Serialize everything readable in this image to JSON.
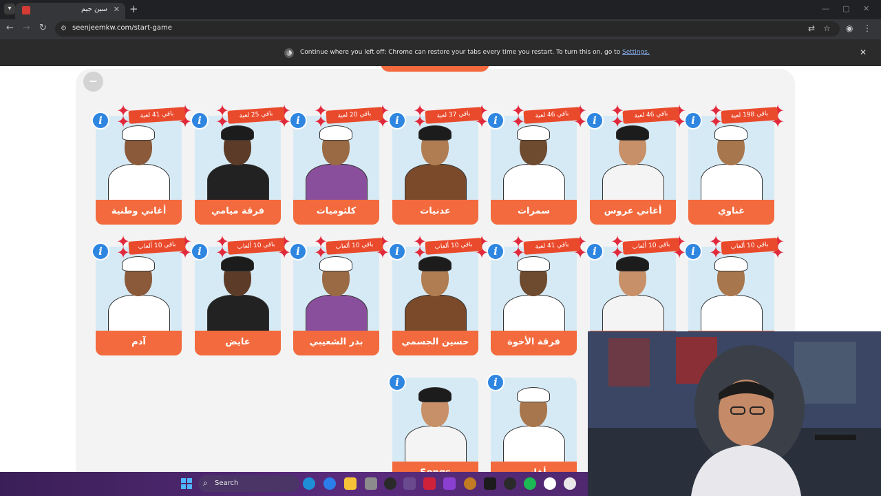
{
  "browser": {
    "tab_title": "سين جيم",
    "url": "seenjeemkw.com/start-game",
    "infobar_message": "Continue where you left off: Chrome can restore your tabs every time you restart. To turn this on, go to",
    "infobar_link": "Settings."
  },
  "categories_row1": [
    {
      "label": "غناوي",
      "badge": "باقي 198 لعبة"
    },
    {
      "label": "أغاني عروس",
      "badge": "باقي 46 لعبة"
    },
    {
      "label": "سمرات",
      "badge": "باقي 46 لعبة"
    },
    {
      "label": "عدنيات",
      "badge": "باقي 37 لعبة"
    },
    {
      "label": "كلثوميات",
      "badge": "باقي 20 لعبة"
    },
    {
      "label": "فرقة ميامي",
      "badge": "باقي 25 لعبة"
    },
    {
      "label": "أغاني وطنية",
      "badge": "باقي 41 لعبة"
    }
  ],
  "categories_row2": [
    {
      "label": "",
      "badge": "باقي 10 ألعاب"
    },
    {
      "label": "",
      "badge": "باقي 10 ألعاب"
    },
    {
      "label": "فرقة الأخوة",
      "badge": "باقي 41 لعبة"
    },
    {
      "label": "حسين الجسمي",
      "badge": "باقي 10 ألعاب"
    },
    {
      "label": "بدر الشعيبي",
      "badge": "باقي 10 ألعاب"
    },
    {
      "label": "عايض",
      "badge": "باقي 10 ألعاب"
    },
    {
      "label": "آدم",
      "badge": "باقي 10 ألعاب"
    }
  ],
  "categories_row3": [
    {
      "label": "أغاني"
    },
    {
      "label": "Songs"
    }
  ],
  "taskbar": {
    "search_placeholder": "Search"
  },
  "icons": {
    "info": "i",
    "minus": "−",
    "star": "✦"
  }
}
